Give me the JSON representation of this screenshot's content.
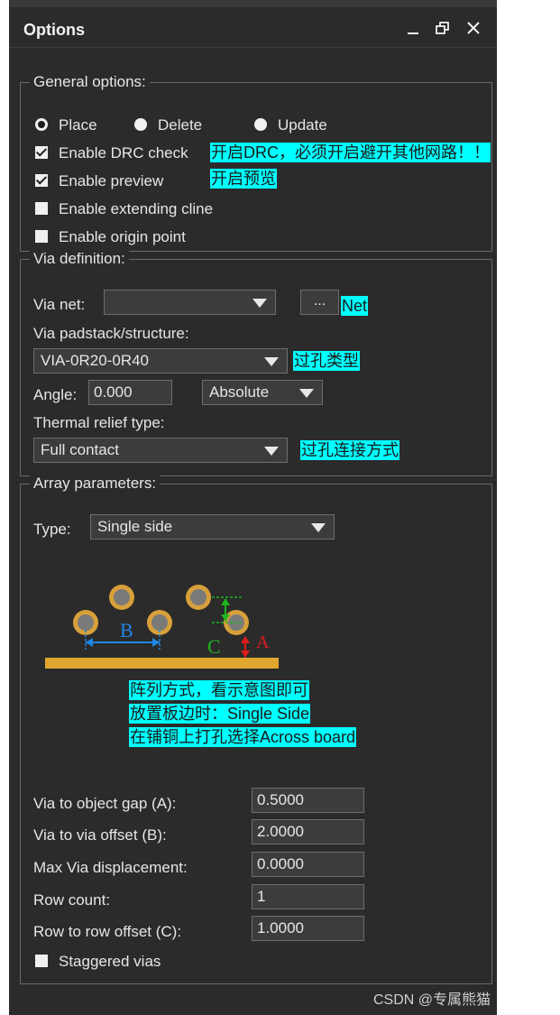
{
  "window": {
    "title": "Options"
  },
  "general": {
    "legend": "General options:",
    "radios": [
      {
        "label": "Place",
        "selected": true
      },
      {
        "label": "Delete",
        "selected": false
      },
      {
        "label": "Update",
        "selected": false
      }
    ],
    "checks": [
      {
        "label": "Enable DRC check",
        "checked": true
      },
      {
        "label": "Enable preview",
        "checked": true
      },
      {
        "label": "Enable extending cline",
        "checked": false
      },
      {
        "label": "Enable origin point",
        "checked": false
      }
    ]
  },
  "via_def": {
    "legend": "Via definition:",
    "net_label": "Via net:",
    "net_value": "",
    "browse_label": "...",
    "padstack_label": "Via padstack/structure:",
    "padstack_value": "VIA-0R20-0R40",
    "angle_label": "Angle:",
    "angle_value": "0.000",
    "angle_mode": "Absolute",
    "thermal_label": "Thermal relief type:",
    "thermal_value": "Full contact"
  },
  "array": {
    "legend": "Array parameters:",
    "type_label": "Type:",
    "type_value": "Single side",
    "diagram_labels": {
      "a": "A",
      "b": "B",
      "c": "C"
    },
    "params": [
      {
        "label": "Via to object gap (A):",
        "value": "0.5000"
      },
      {
        "label": "Via to via offset (B):",
        "value": "2.0000"
      },
      {
        "label": "Max Via displacement:",
        "value": "0.0000"
      },
      {
        "label": "Row count:",
        "value": "1"
      },
      {
        "label": "Row to row offset (C):",
        "value": "1.0000"
      }
    ],
    "staggered_label": "Staggered vias",
    "staggered_checked": false
  },
  "annotations": {
    "drc": "开启DRC，必须开启避开其他网路！！",
    "preview": "开启预览",
    "net": "Net",
    "via_type": "过孔类型",
    "thermal": "过孔连接方式",
    "array_1": "阵列方式，看示意图即可",
    "array_2": "放置板边时：Single Side",
    "array_3": "在铺铜上打孔选择Across board"
  },
  "watermark": "CSDN @专属熊猫",
  "colors": {
    "panel_bg": "#2b2b2b",
    "highlight": "#00ffff",
    "board": "#dfa72f",
    "via": "#d8a03a",
    "dim_b": "#1e88e5",
    "dim_c": "#1eb41e",
    "dim_a": "#e01b1b"
  }
}
